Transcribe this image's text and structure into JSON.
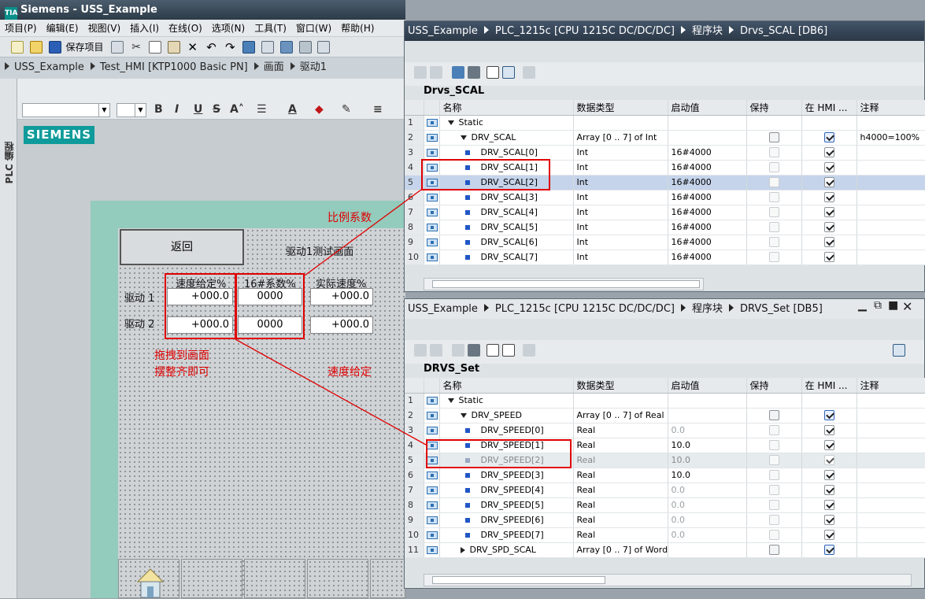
{
  "app": {
    "title": "Siemens - USS_Example",
    "logo": "TIA"
  },
  "menu": [
    "项目(P)",
    "编辑(E)",
    "视图(V)",
    "插入(I)",
    "在线(O)",
    "选项(N)",
    "工具(T)",
    "窗口(W)",
    "帮助(H)"
  ],
  "toolbar": {
    "save_label": "保存项目"
  },
  "breadcrumb_left": [
    "USS_Example",
    "Test_HMI [KTP1000 Basic PN]",
    "画面",
    "驱动1"
  ],
  "sidebar_label": "PLC 编程",
  "format_buttons": [
    "B",
    "I",
    "U",
    "S",
    "A"
  ],
  "hmi": {
    "logo": "SIEMENS",
    "back_button": "返回",
    "screen_title": "驱动1测试画面",
    "col_speed_setpoint": "速度给定%",
    "col_factor": "16#系数%",
    "col_actual": "实际速度%",
    "drive1": "驱动 1",
    "drive2": "驱动 2",
    "d1_speed": "+000.0",
    "d1_factor": "0000",
    "d1_actual": "+000.0",
    "d2_speed": "+000.0",
    "d2_factor": "0000",
    "d2_actual": "+000.0"
  },
  "annotations": {
    "scale": "比例系数",
    "drag_line1": "拖拽到画面",
    "drag_line2": "摆整齐即可",
    "speed": "速度给定"
  },
  "win1": {
    "breadcrumb": [
      "USS_Example",
      "PLC_1215c [CPU 1215C DC/DC/DC]",
      "程序块",
      "Drvs_SCAL [DB6]"
    ],
    "db_name": "Drvs_SCAL",
    "headers": [
      "名称",
      "数据类型",
      "启动值",
      "保持",
      "在 HMI ...",
      "注释"
    ],
    "rows": [
      {
        "n": "1",
        "name": "Static",
        "type": "",
        "start": "",
        "comment": ""
      },
      {
        "n": "2",
        "name": "DRV_SCAL",
        "type": "Array [0 .. 7] of Int",
        "start": "",
        "comment": "h4000=100%"
      },
      {
        "n": "3",
        "name": "DRV_SCAL[0]",
        "type": "Int",
        "start": "16#4000",
        "comment": ""
      },
      {
        "n": "4",
        "name": "DRV_SCAL[1]",
        "type": "Int",
        "start": "16#4000",
        "comment": ""
      },
      {
        "n": "5",
        "name": "DRV_SCAL[2]",
        "type": "Int",
        "start": "16#4000",
        "comment": ""
      },
      {
        "n": "6",
        "name": "DRV_SCAL[3]",
        "type": "Int",
        "start": "16#4000",
        "comment": ""
      },
      {
        "n": "7",
        "name": "DRV_SCAL[4]",
        "type": "Int",
        "start": "16#4000",
        "comment": ""
      },
      {
        "n": "8",
        "name": "DRV_SCAL[5]",
        "type": "Int",
        "start": "16#4000",
        "comment": ""
      },
      {
        "n": "9",
        "name": "DRV_SCAL[6]",
        "type": "Int",
        "start": "16#4000",
        "comment": ""
      },
      {
        "n": "10",
        "name": "DRV_SCAL[7]",
        "type": "Int",
        "start": "16#4000",
        "comment": ""
      }
    ]
  },
  "win2": {
    "breadcrumb": [
      "USS_Example",
      "PLC_1215c [CPU 1215C DC/DC/DC]",
      "程序块",
      "DRVS_Set [DB5]"
    ],
    "db_name": "DRVS_Set",
    "headers": [
      "名称",
      "数据类型",
      "启动值",
      "保持",
      "在 HMI ...",
      "注释"
    ],
    "rows": [
      {
        "n": "1",
        "name": "Static",
        "type": "",
        "start": ""
      },
      {
        "n": "2",
        "name": "DRV_SPEED",
        "type": "Array [0 .. 7] of Real",
        "start": ""
      },
      {
        "n": "3",
        "name": "DRV_SPEED[0]",
        "type": "Real",
        "start": "0.0"
      },
      {
        "n": "4",
        "name": "DRV_SPEED[1]",
        "type": "Real",
        "start": "10.0"
      },
      {
        "n": "5",
        "name": "DRV_SPEED[2]",
        "type": "Real",
        "start": "10.0"
      },
      {
        "n": "6",
        "name": "DRV_SPEED[3]",
        "type": "Real",
        "start": "10.0"
      },
      {
        "n": "7",
        "name": "DRV_SPEED[4]",
        "type": "Real",
        "start": "0.0"
      },
      {
        "n": "8",
        "name": "DRV_SPEED[5]",
        "type": "Real",
        "start": "0.0"
      },
      {
        "n": "9",
        "name": "DRV_SPEED[6]",
        "type": "Real",
        "start": "0.0"
      },
      {
        "n": "10",
        "name": "DRV_SPEED[7]",
        "type": "Real",
        "start": "0.0"
      },
      {
        "n": "11",
        "name": "DRV_SPD_SCAL",
        "type": "Array [0 .. 7] of Word",
        "start": ""
      }
    ]
  },
  "colors": {
    "accent": "#0f9b9b",
    "annotation": "#e00000",
    "screen_bg": "#93cbbd"
  }
}
